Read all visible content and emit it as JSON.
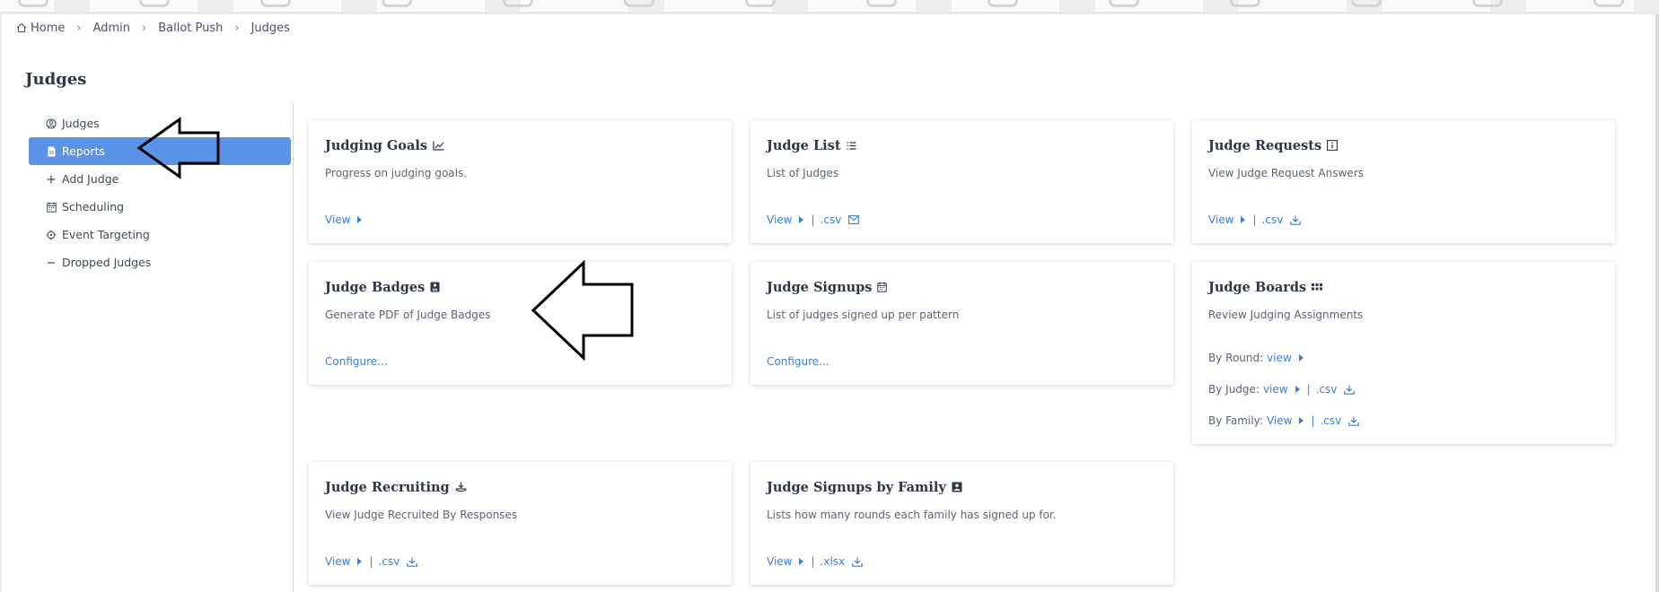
{
  "breadcrumb": {
    "items": [
      "Home",
      "Admin",
      "Ballot Push",
      "Judges"
    ]
  },
  "page": {
    "title": "Judges"
  },
  "sidebar": {
    "items": [
      {
        "label": "Judges",
        "icon": "user-circle-icon",
        "active": false
      },
      {
        "label": "Reports",
        "icon": "document-icon",
        "active": true
      },
      {
        "label": "Add Judge",
        "icon": "plus-icon",
        "active": false
      },
      {
        "label": "Scheduling",
        "icon": "calendar-icon",
        "active": false
      },
      {
        "label": "Event Targeting",
        "icon": "target-icon",
        "active": false
      },
      {
        "label": "Dropped Judges",
        "icon": "minus-icon",
        "active": false
      }
    ]
  },
  "cards": {
    "judging_goals": {
      "title": "Judging Goals",
      "icon": "chart-line-icon",
      "desc": "Progress on judging goals.",
      "view": "View"
    },
    "judge_list": {
      "title": "Judge List",
      "icon": "list-icon",
      "desc": "List of Judges",
      "view": "View",
      "pipe": "|",
      "csv": ".csv",
      "extra_icon": "email-icon"
    },
    "judge_requests": {
      "title": "Judge Requests",
      "icon": "info-box-icon",
      "desc": "View Judge Request Answers",
      "view": "View",
      "pipe": "|",
      "csv": ".csv",
      "extra_icon": "download-icon"
    },
    "judge_badges": {
      "title": "Judge Badges",
      "icon": "badge-icon",
      "desc": "Generate PDF of Judge Badges",
      "configure": "Configure..."
    },
    "judge_signups": {
      "title": "Judge Signups",
      "icon": "calendar-icon",
      "desc": "List of judges signed up per pattern",
      "configure": "Configure..."
    },
    "judge_boards": {
      "title": "Judge Boards",
      "icon": "grid-icon",
      "desc": "Review Judging Assignments",
      "by_round_label": "By Round:",
      "by_round_view": "view",
      "by_judge_label": "By Judge:",
      "by_judge_view": "view",
      "by_judge_csv": ".csv",
      "by_family_label": "By Family:",
      "by_family_view": "View",
      "by_family_csv": ".csv",
      "pipe": "|"
    },
    "judge_recruiting": {
      "title": "Judge Recruiting",
      "icon": "recruit-icon",
      "desc": "View Judge Recruited By Responses",
      "view": "View",
      "pipe": "|",
      "csv": ".csv",
      "extra_icon": "download-icon"
    },
    "judge_signups_family": {
      "title": "Judge Signups by Family",
      "icon": "family-icon",
      "desc": "Lists how many rounds each family has signed up for.",
      "view": "View",
      "pipe": "|",
      "xlsx": ".xlsx",
      "extra_icon": "download-icon"
    }
  },
  "colors": {
    "accent": "#5b93e8",
    "link": "#3a7fd5",
    "text": "#2d3748"
  }
}
